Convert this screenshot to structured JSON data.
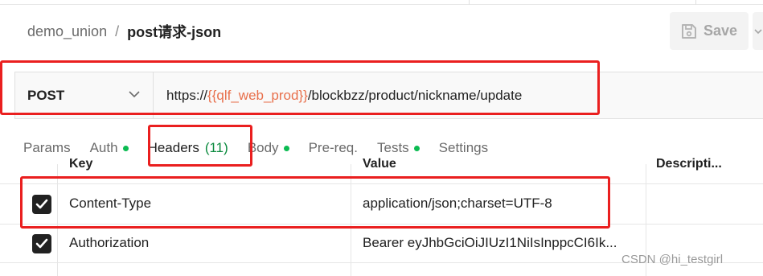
{
  "breadcrumb": {
    "collection": "demo_union",
    "separator": "/",
    "request_name": "post请求-json"
  },
  "toolbar": {
    "save_label": "Save",
    "save_icon": "floppy-disk-icon"
  },
  "request": {
    "method": "POST",
    "url_prefix": "https://",
    "url_variable": "{{qlf_web_prod}}",
    "url_path": "/blockbzz/product/nickname/update"
  },
  "tabs": [
    {
      "label": "Params",
      "indicator": false
    },
    {
      "label": "Auth",
      "indicator": true
    },
    {
      "label": "Headers",
      "count": "(11)",
      "active": true
    },
    {
      "label": "Body",
      "indicator": true
    },
    {
      "label": "Pre-req.",
      "indicator": false
    },
    {
      "label": "Tests",
      "indicator": true
    },
    {
      "label": "Settings",
      "indicator": false
    }
  ],
  "headers_table": {
    "columns": [
      "Key",
      "Value",
      "Descripti..."
    ],
    "rows": [
      {
        "checked": true,
        "key": "Content-Type",
        "value": "application/json;charset=UTF-8"
      },
      {
        "checked": true,
        "key": "Authorization",
        "value": "Bearer eyJhbGciOiJIUzI1NiIsInppcCI6Ik..."
      }
    ]
  },
  "watermark": "CSDN @hi_testgirl",
  "colors": {
    "variable": "#e8704c",
    "indicator_dot": "#0cbb52",
    "annotation_box": "#ea1f1f"
  }
}
